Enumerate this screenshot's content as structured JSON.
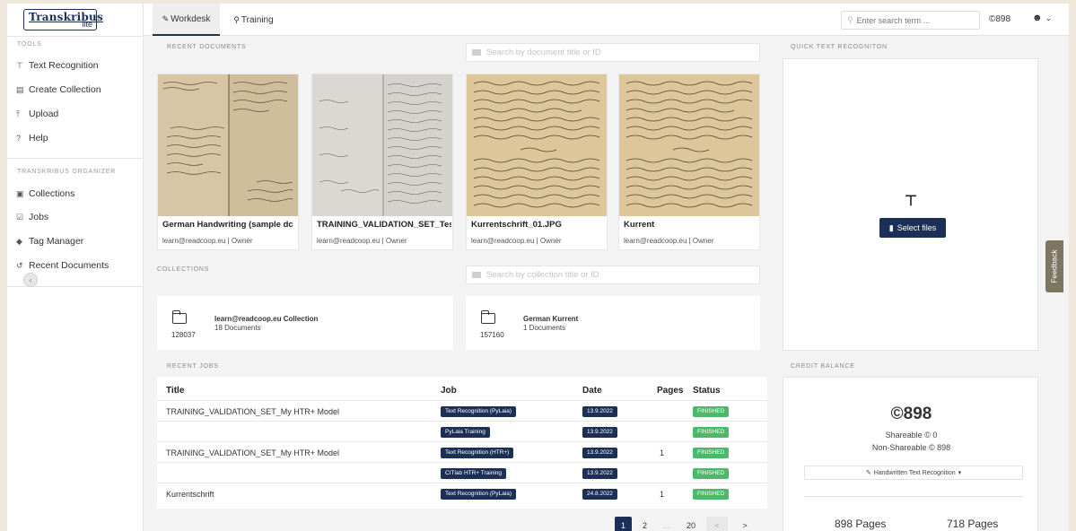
{
  "sidebar": {
    "logo_text": "Transkribus",
    "logo_sub": "lite",
    "tools_title": "TOOLS",
    "tools": [
      {
        "label": "Text Recognition",
        "icon": "text-recognition-icon"
      },
      {
        "label": "Create Collection",
        "icon": "create-collection-icon"
      },
      {
        "label": "Upload",
        "icon": "upload-icon"
      },
      {
        "label": "Help",
        "icon": "help-icon"
      }
    ],
    "organizer_title": "TRANSKRIBUS ORGANIZER",
    "organizer": [
      {
        "label": "Collections",
        "icon": "collections-icon"
      },
      {
        "label": "Jobs",
        "icon": "jobs-icon"
      },
      {
        "label": "Tag Manager",
        "icon": "tag-icon"
      },
      {
        "label": "Recent Documents",
        "icon": "history-icon"
      }
    ]
  },
  "topbar": {
    "tabs": [
      {
        "label": "Workdesk",
        "icon": "pencil-icon",
        "active": true
      },
      {
        "label": "Training",
        "icon": "lightbulb-icon",
        "active": false
      }
    ],
    "search_placeholder": "Enter search term ...",
    "credits": "898"
  },
  "recent_documents": {
    "label": "RECENT DOCUMENTS",
    "search_placeholder": "Search by document title or ID",
    "items": [
      {
        "title": "German Handwriting (sample dc",
        "owner": "learn@readcoop.eu | Owner"
      },
      {
        "title": "TRAINING_VALIDATION_SET_Tes",
        "owner": "learn@readcoop.eu | Owner"
      },
      {
        "title": "Kurrentschrift_01.JPG",
        "owner": "learn@readcoop.eu | Owner"
      },
      {
        "title": "Kurrent",
        "owner": "learn@readcoop.eu | Owner"
      }
    ]
  },
  "collections": {
    "label": "COLLECTIONS",
    "search_placeholder": "Search by collection title or ID",
    "items": [
      {
        "id": "128037",
        "name": "learn@readcoop.eu Collection",
        "count": "18 Documents"
      },
      {
        "id": "157160",
        "name": "German Kurrent",
        "count": "1 Documents"
      }
    ]
  },
  "recent_jobs": {
    "label": "RECENT JOBS",
    "headers": {
      "title": "Title",
      "job": "Job",
      "date": "Date",
      "pages": "Pages",
      "status": "Status"
    },
    "rows": [
      {
        "title": "TRAINING_VALIDATION_SET_My HTR+ Model",
        "job": "Text Recognition (PyLaia)",
        "date": "13.9.2022",
        "pages": "",
        "status": "FINISHED"
      },
      {
        "title": "",
        "job": "PyLaia Training",
        "date": "13.9.2022",
        "pages": "",
        "status": "FINISHED"
      },
      {
        "title": "TRAINING_VALIDATION_SET_My HTR+ Model",
        "job": "Text Recognition (HTR+)",
        "date": "13.9.2022",
        "pages": "1",
        "status": "FINISHED"
      },
      {
        "title": "",
        "job": "CITlab HTR+ Training",
        "date": "13.9.2022",
        "pages": "",
        "status": "FINISHED"
      },
      {
        "title": "Kurrentschrift",
        "job": "Text Recognition (PyLaia)",
        "date": "24.8.2022",
        "pages": "1",
        "status": "FINISHED"
      }
    ],
    "pagination": {
      "pages": [
        "1",
        "2",
        "...",
        "20"
      ],
      "current": "1",
      "prev": "<",
      "next": ">"
    }
  },
  "quick_text": {
    "label": "QUICK TEXT RECOGNITON",
    "button": "Select files"
  },
  "credit_balance": {
    "label": "CREDIT BALANCE",
    "total": "898",
    "shareable": "Shareable © 0",
    "non_shareable": "Non-Shareable © 898",
    "model_select": "Handwritten Text Recognition",
    "pages_left": "898 Pages",
    "pages_right": "718 Pages"
  },
  "feedback_label": "Feedback",
  "colors": {
    "brand": "#1c2f56",
    "success": "#4cb86a"
  }
}
